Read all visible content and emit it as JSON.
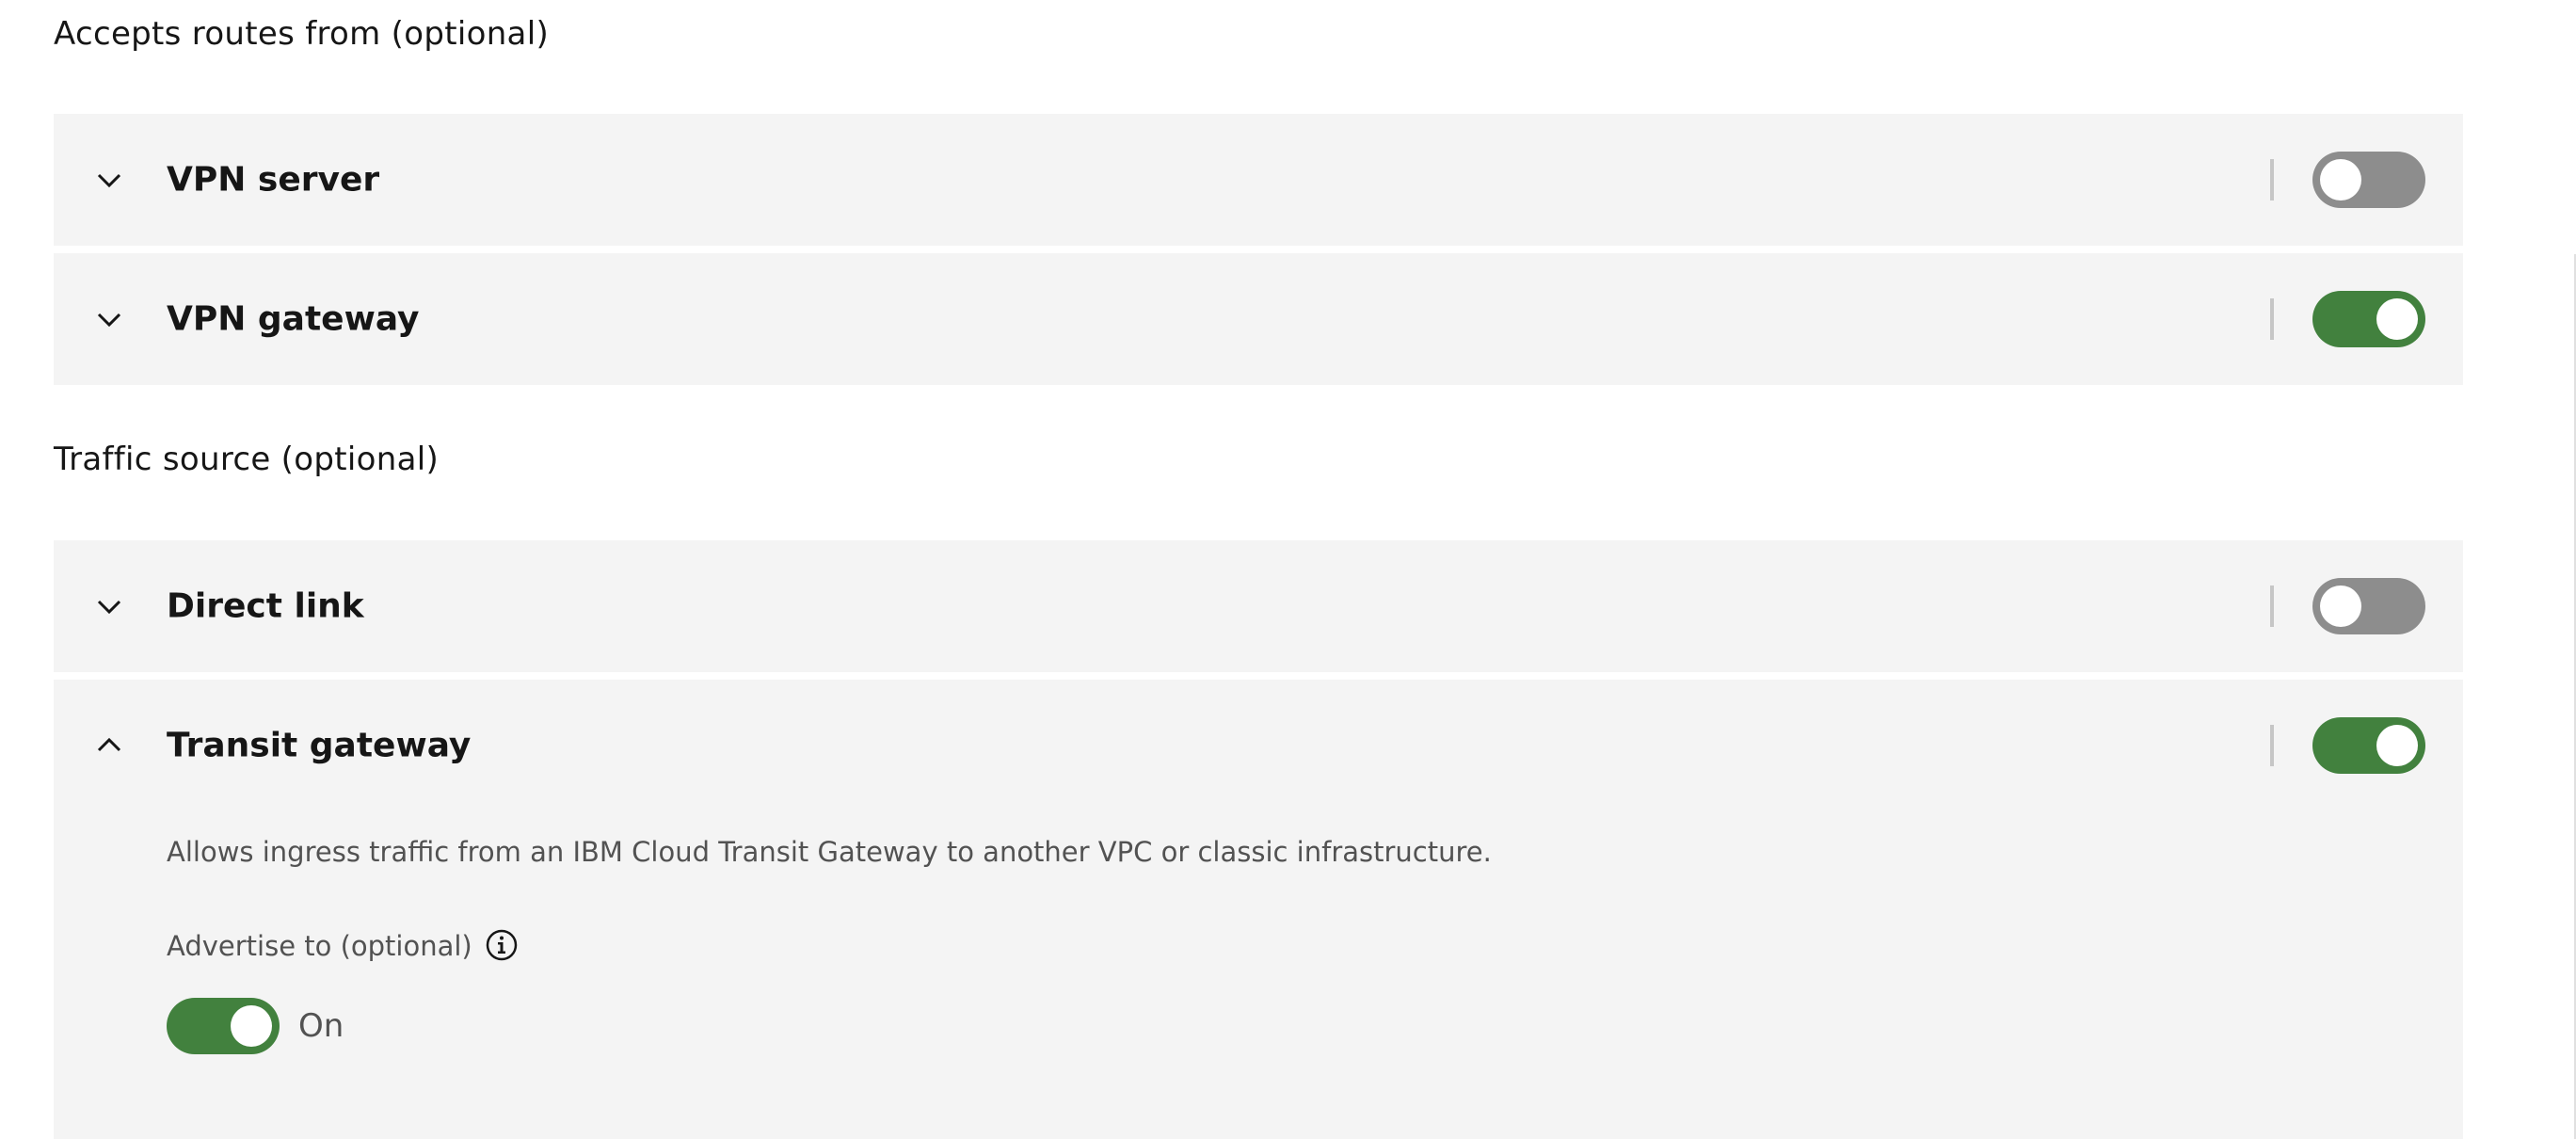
{
  "sections": {
    "accepts_routes": {
      "title": "Accepts routes from (optional)",
      "rows": [
        {
          "label": "VPN server",
          "enabled": false,
          "expanded": false
        },
        {
          "label": "VPN gateway",
          "enabled": true,
          "expanded": false
        }
      ]
    },
    "traffic_source": {
      "title": "Traffic source (optional)",
      "rows": [
        {
          "label": "Direct link",
          "enabled": false,
          "expanded": false
        },
        {
          "label": "Transit gateway",
          "enabled": true,
          "expanded": true,
          "description": "Allows ingress traffic from an IBM Cloud Transit Gateway to another VPC or classic infrastructure.",
          "advertise": {
            "label": "Advertise to (optional)",
            "enabled": true,
            "state_text": "On"
          }
        }
      ]
    }
  },
  "icons": {
    "collapsed": "chevron-down-icon",
    "expanded": "chevron-up-icon",
    "info": "information-icon"
  },
  "colors": {
    "toggle_on": "#42813e",
    "toggle_off": "#8d8d8d",
    "row_background": "#f4f4f4"
  }
}
